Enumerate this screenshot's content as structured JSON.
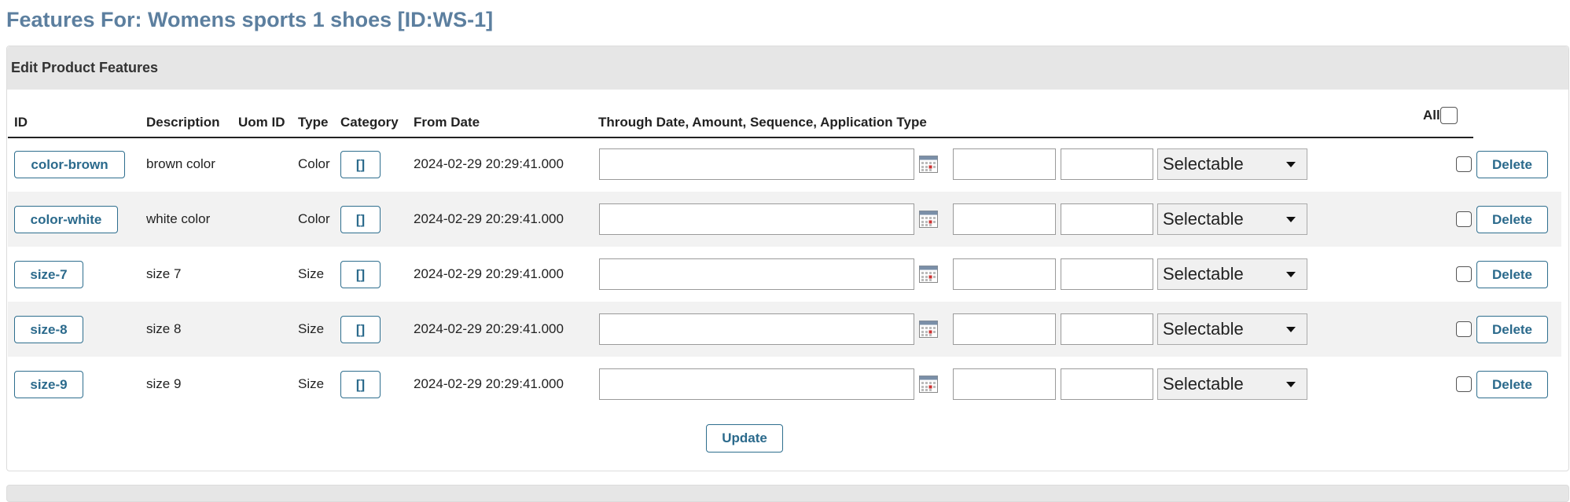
{
  "page_title": "Features For: Womens sports 1 shoes [ID:WS-1]",
  "panel_title": "Edit Product Features",
  "columns": {
    "id": "ID",
    "description": "Description",
    "uom_id": "Uom ID",
    "type": "Type",
    "category": "Category",
    "from_date": "From Date",
    "through": "Through Date, Amount, Sequence, Application Type",
    "all": "All"
  },
  "rows": [
    {
      "id": "color-brown",
      "description": "brown color",
      "type": "Color",
      "category": "[]",
      "from_date": "2024-02-29 20:29:41.000",
      "application_type": "Selectable",
      "delete_label": "Delete"
    },
    {
      "id": "color-white",
      "description": "white color",
      "type": "Color",
      "category": "[]",
      "from_date": "2024-02-29 20:29:41.000",
      "application_type": "Selectable",
      "delete_label": "Delete"
    },
    {
      "id": "size-7",
      "description": "size 7",
      "type": "Size",
      "category": "[]",
      "from_date": "2024-02-29 20:29:41.000",
      "application_type": "Selectable",
      "delete_label": "Delete"
    },
    {
      "id": "size-8",
      "description": "size 8",
      "type": "Size",
      "category": "[]",
      "from_date": "2024-02-29 20:29:41.000",
      "application_type": "Selectable",
      "delete_label": "Delete"
    },
    {
      "id": "size-9",
      "description": "size 9",
      "type": "Size",
      "category": "[]",
      "from_date": "2024-02-29 20:29:41.000",
      "application_type": "Selectable",
      "delete_label": "Delete"
    }
  ],
  "update_label": "Update",
  "icons": {
    "calendar": "calendar-icon",
    "dropdown": "chevron-down-icon"
  },
  "colors": {
    "title": "#5c7f9f",
    "button_text": "#2b6a8c",
    "header_bg": "#e6e6e6",
    "alt_row_bg": "#f2f2f2"
  }
}
